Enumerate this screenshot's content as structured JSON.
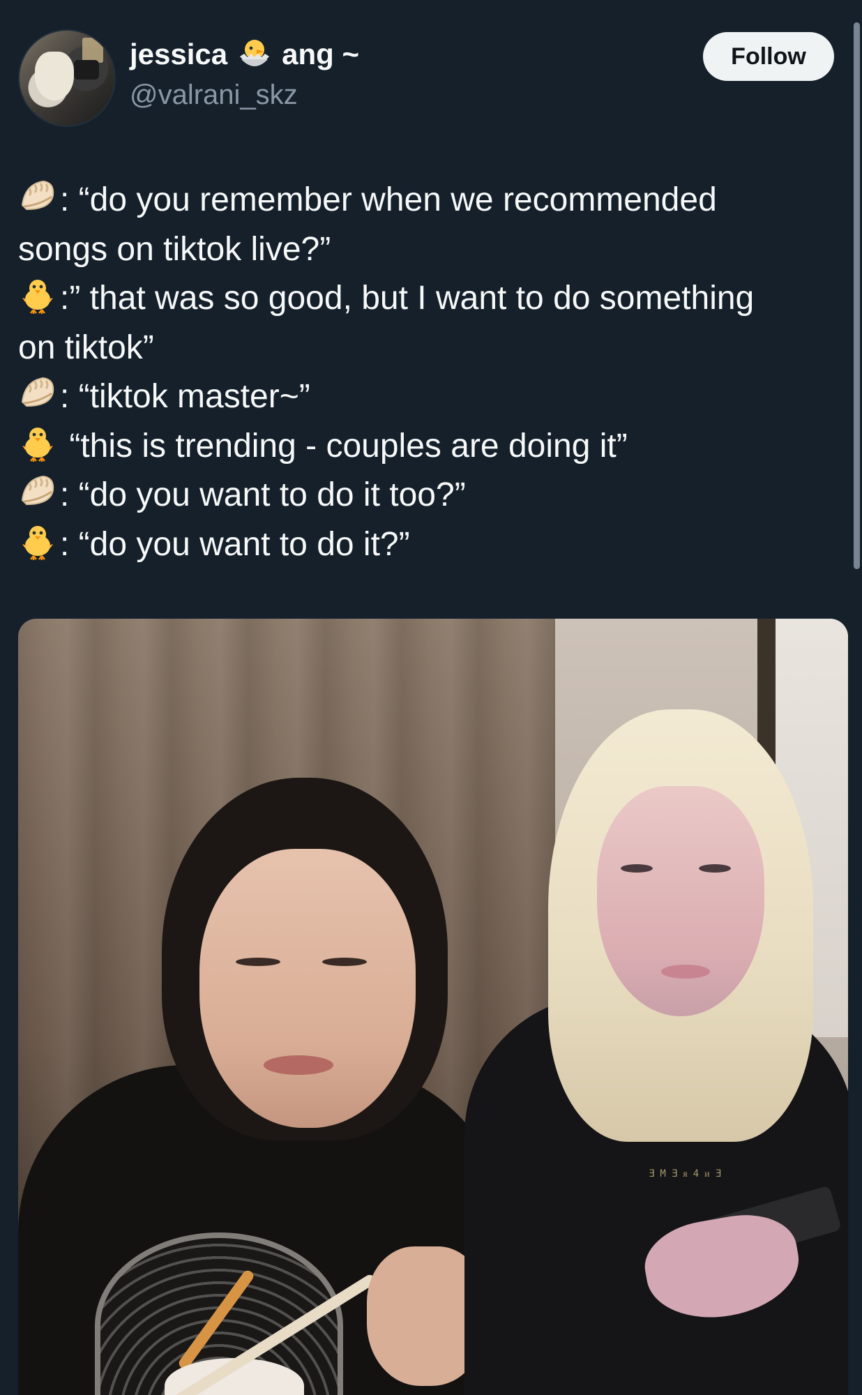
{
  "user": {
    "display_name_start": "jessica",
    "display_name_emoji": "hatching-chick",
    "display_name_end": "ang ~",
    "handle": "@valrani_skz"
  },
  "follow_label": "Follow",
  "tweet": {
    "lines": [
      {
        "emoji": "dumpling",
        "text": ": “do you remember when we recommended"
      },
      {
        "emoji": "",
        "text": "songs on tiktok live?”"
      },
      {
        "emoji": "baby-chick",
        "text": ":” that was so good, but I want to do something"
      },
      {
        "emoji": "",
        "text": "on tiktok”"
      },
      {
        "emoji": "dumpling",
        "text": ": “tiktok master~”"
      },
      {
        "emoji": "baby-chick",
        "text": " “this is trending - couples are doing it”"
      },
      {
        "emoji": "dumpling",
        "text": ": “do you want to do it too?”"
      },
      {
        "emoji": "baby-chick",
        "text": ": “do you want to do it?”"
      }
    ]
  },
  "media": {
    "shirt_text": "ƎMƎᴙ4ᴎƎ"
  },
  "colors": {
    "background": "#15202b",
    "text_primary": "#f7f9f9",
    "text_secondary": "#8b98a5",
    "follow_bg": "#eff3f4",
    "follow_text": "#0f1419"
  }
}
